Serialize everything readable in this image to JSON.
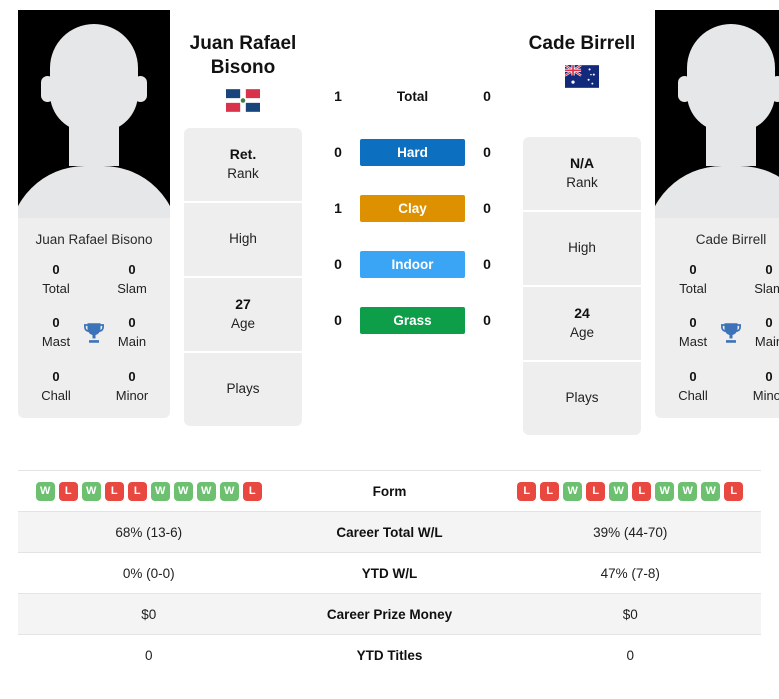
{
  "players": {
    "left": {
      "name_line1": "Juan Rafael",
      "name_line2": "Bisono",
      "full_name": "Juan Rafael Bisono",
      "country_flag": "dominican-republic-flag",
      "rank_value": "Ret.",
      "rank_label": "Rank",
      "high_label": "High",
      "age_value": "27",
      "age_label": "Age",
      "plays_label": "Plays",
      "titles": [
        {
          "value": "0",
          "label": "Total"
        },
        {
          "value": "0",
          "label": "Slam"
        },
        {
          "value": "0",
          "label": "Mast"
        },
        {
          "value": "0",
          "label": "Main"
        },
        {
          "value": "0",
          "label": "Chall"
        },
        {
          "value": "0",
          "label": "Minor"
        }
      ],
      "surface_wins": {
        "total": "1",
        "hard": "0",
        "clay": "1",
        "indoor": "0",
        "grass": "0"
      },
      "form": [
        "W",
        "L",
        "W",
        "L",
        "L",
        "W",
        "W",
        "W",
        "W",
        "L"
      ],
      "career_total_wl": "68% (13-6)",
      "ytd_wl": "0% (0-0)",
      "career_prize_money": "$0",
      "ytd_titles": "0"
    },
    "right": {
      "name_line1": "Cade Birrell",
      "name_line2": "",
      "full_name": "Cade Birrell",
      "country_flag": "australia-flag",
      "rank_value": "N/A",
      "rank_label": "Rank",
      "high_label": "High",
      "age_value": "24",
      "age_label": "Age",
      "plays_label": "Plays",
      "titles": [
        {
          "value": "0",
          "label": "Total"
        },
        {
          "value": "0",
          "label": "Slam"
        },
        {
          "value": "0",
          "label": "Mast"
        },
        {
          "value": "0",
          "label": "Main"
        },
        {
          "value": "0",
          "label": "Chall"
        },
        {
          "value": "0",
          "label": "Minor"
        }
      ],
      "surface_wins": {
        "total": "0",
        "hard": "0",
        "clay": "0",
        "indoor": "0",
        "grass": "0"
      },
      "form": [
        "L",
        "L",
        "W",
        "L",
        "W",
        "L",
        "W",
        "W",
        "W",
        "L"
      ],
      "career_total_wl": "39% (44-70)",
      "ytd_wl": "47% (7-8)",
      "career_prize_money": "$0",
      "ytd_titles": "0"
    }
  },
  "surfaces": [
    {
      "key": "total",
      "label": "Total",
      "color": "transparent",
      "text_color": "#111111"
    },
    {
      "key": "hard",
      "label": "Hard",
      "color": "#0d6fbf",
      "text_color": "#ffffff"
    },
    {
      "key": "clay",
      "label": "Clay",
      "color": "#dd9000",
      "text_color": "#ffffff"
    },
    {
      "key": "indoor",
      "label": "Indoor",
      "color": "#3aa5f5",
      "text_color": "#ffffff"
    },
    {
      "key": "grass",
      "label": "Grass",
      "color": "#0e9e4a",
      "text_color": "#ffffff"
    }
  ],
  "table_rows": [
    {
      "label": "Form",
      "type": "form"
    },
    {
      "label": "Career Total W/L",
      "type": "text",
      "key": "career_total_wl"
    },
    {
      "label": "YTD W/L",
      "type": "text",
      "key": "ytd_wl"
    },
    {
      "label": "Career Prize Money",
      "type": "text",
      "key": "career_prize_money"
    },
    {
      "label": "YTD Titles",
      "type": "text",
      "key": "ytd_titles"
    }
  ],
  "colors": {
    "win_badge": "#6cc070",
    "loss_badge": "#e8483f",
    "card_bg": "#eeeeee",
    "row_alt_bg": "#f4f4f4",
    "trophy": "#3b72b8"
  }
}
